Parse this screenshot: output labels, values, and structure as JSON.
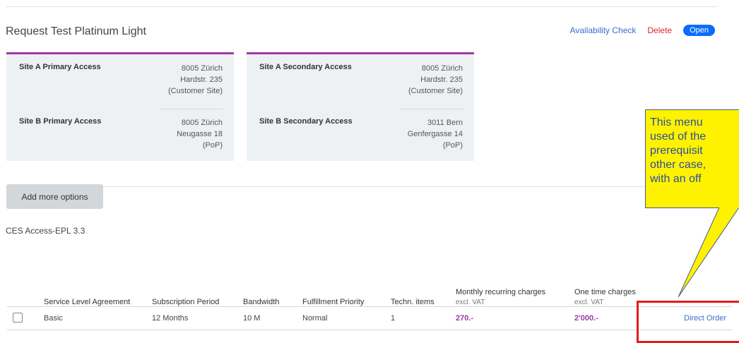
{
  "request": {
    "title": "Request Test Platinum Light",
    "availability_check": "Availability Check",
    "delete": "Delete",
    "status": "Open"
  },
  "sites": [
    {
      "top_label": "Site A Primary Access",
      "top_lines": [
        "8005 Zürich",
        "Hardstr. 235",
        "(Customer Site)"
      ],
      "bottom_label": "Site B Primary Access",
      "bottom_lines": [
        "8005 Zürich",
        "Neugasse 18",
        "(PoP)"
      ]
    },
    {
      "top_label": "Site A Secondary Access",
      "top_lines": [
        "8005 Zürich",
        "Hardstr. 235",
        "(Customer Site)"
      ],
      "bottom_label": "Site B Secondary Access",
      "bottom_lines": [
        "3011 Bern",
        "Genfergasse 14",
        "(PoP)"
      ]
    }
  ],
  "add_options": "Add more options",
  "product_name": "CES Access-EPL 3.3",
  "table": {
    "headers": [
      "Service Level Agreement",
      "Subscription Period",
      "Bandwidth",
      "Fulfillment Priority",
      "Techn. items",
      "Monthly recurring charges",
      "One time charges"
    ],
    "header_sub": {
      "monthly": "excl. VAT",
      "onetime": "excl. VAT"
    },
    "rows": [
      {
        "sla": "Basic",
        "period": "12 Months",
        "bandwidth": "10 M",
        "priority": "Normal",
        "items": "1",
        "monthly": "270.-",
        "onetime": "2'000.-",
        "action": "Direct Order"
      }
    ]
  },
  "callout": {
    "lines": [
      "This menu",
      "used of the",
      "prerequisit",
      "other case,",
      "with an off"
    ]
  },
  "colors": {
    "accent_purple": "#9b3aa5",
    "link_blue": "#3a6ccf",
    "delete_red": "#e0242f",
    "callout_yellow": "#fff200",
    "highlight_red": "#e31b1b"
  }
}
